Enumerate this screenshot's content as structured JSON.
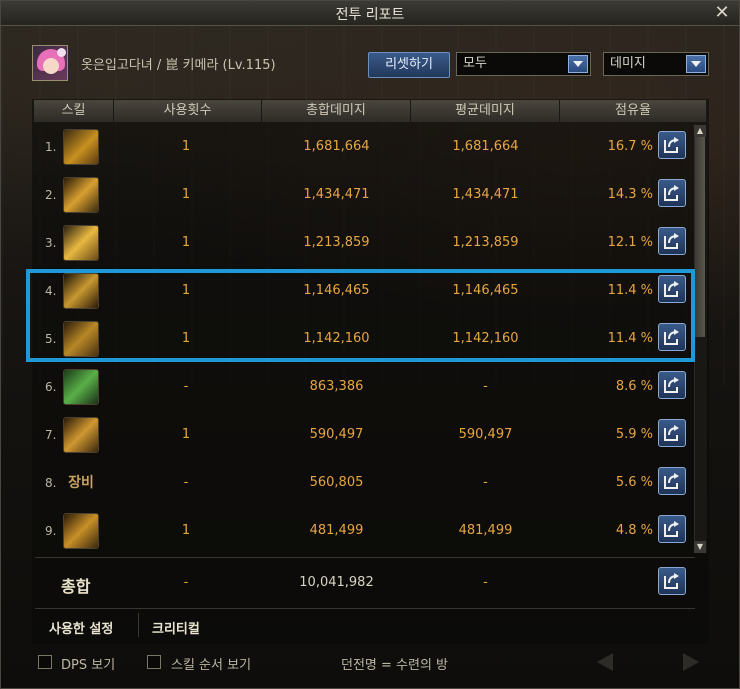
{
  "window": {
    "title": "전투 리포트"
  },
  "character": {
    "name": "옷은입고다녀 / 崑 키메라 (Lv.115)"
  },
  "controls": {
    "reset_label": "리셋하기",
    "filter_value": "모두",
    "metric_value": "데미지"
  },
  "columns": [
    "스킬",
    "사용횟수",
    "총합데미지",
    "평균데미지",
    "점유율"
  ],
  "rows": [
    {
      "rank": "1.",
      "icon": "skill-icon-1",
      "uses": "1",
      "total": "1,681,664",
      "avg": "1,681,664",
      "share": "16.7 %"
    },
    {
      "rank": "2.",
      "icon": "skill-icon-2",
      "uses": "1",
      "total": "1,434,471",
      "avg": "1,434,471",
      "share": "14.3 %"
    },
    {
      "rank": "3.",
      "icon": "skill-icon-3",
      "uses": "1",
      "total": "1,213,859",
      "avg": "1,213,859",
      "share": "12.1 %"
    },
    {
      "rank": "4.",
      "icon": "skill-icon-4",
      "uses": "1",
      "total": "1,146,465",
      "avg": "1,146,465",
      "share": "11.4 %"
    },
    {
      "rank": "5.",
      "icon": "skill-icon-5",
      "uses": "1",
      "total": "1,142,160",
      "avg": "1,142,160",
      "share": "11.4 %"
    },
    {
      "rank": "6.",
      "icon": "skill-icon-6",
      "uses": "-",
      "total": "863,386",
      "avg": "-",
      "share": "8.6 %"
    },
    {
      "rank": "7.",
      "icon": "skill-icon-7",
      "uses": "1",
      "total": "590,497",
      "avg": "590,497",
      "share": "5.9 %"
    },
    {
      "rank": "8.",
      "icon": "equipment-text-icon",
      "icon_text": "장비",
      "uses": "-",
      "total": "560,805",
      "avg": "-",
      "share": "5.6 %"
    },
    {
      "rank": "9.",
      "icon": "skill-icon-9",
      "uses": "1",
      "total": "481,499",
      "avg": "481,499",
      "share": "4.8 %"
    }
  ],
  "total_row": {
    "label": "총합",
    "uses": "-",
    "total": "10,041,982",
    "avg": "-"
  },
  "settings": {
    "used_label": "사용한 설정",
    "critical_label": "크리티컬"
  },
  "footer": {
    "dps_label": "DPS 보기",
    "skill_order_label": "스킬 순서 보기",
    "dungeon_label": "던전명 = 수련의 방"
  },
  "colors": {
    "accent_blue": "#1e9ad8",
    "value_orange": "#e8a640"
  }
}
